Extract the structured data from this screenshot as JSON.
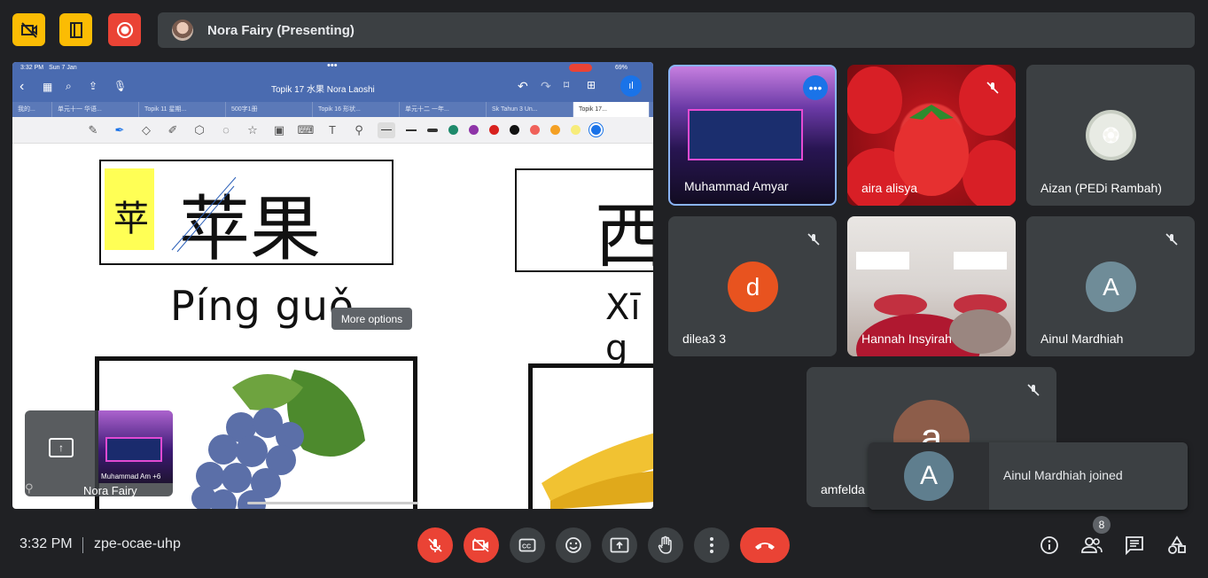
{
  "colors": {
    "bg": "#202124",
    "surface": "#3c4043",
    "yellow": "#fbbc04",
    "red": "#ea4335",
    "tileBorderActive": "#8ab4f8"
  },
  "topbar": {
    "presenter_name": "Nora Fairy (Presenting)"
  },
  "presentation": {
    "status_time": "3:32 PM",
    "status_date": "Sun 7 Jan",
    "status_battery": "69%",
    "doc_title": "Topik 17 水果  Nora Laoshi",
    "tabs": [
      "我的...",
      "单元十一 华语...",
      "Topik 11 星期...",
      "500字1册",
      "Topik 16 形状...",
      "单元十二 一年...",
      "Sk Tahun 3 Un...",
      "Topik 17..."
    ],
    "card1": {
      "small": "苹",
      "big": "苹果",
      "pinyin": "Píng guǒ"
    },
    "card2": {
      "big": "西",
      "pinyin": "Xī g"
    },
    "tooltip": "More options",
    "self_view": {
      "name": "Nora Fairy",
      "thumb_label": "Muhammad Am +6"
    }
  },
  "participants": [
    {
      "name": "Muhammad Amyar",
      "type": "video"
    },
    {
      "name": "aira alisya",
      "type": "video"
    },
    {
      "name": "Aizan (PEDi Rambah)",
      "type": "photo"
    },
    {
      "name": "dilea3 3",
      "type": "letter",
      "letter": "d",
      "color": "#e8531f"
    },
    {
      "name": "Hannah Insyirah",
      "type": "video"
    },
    {
      "name": "Ainul Mardhiah",
      "type": "letter",
      "letter": "A",
      "color": "#6f8c98"
    },
    {
      "name": "amfelda",
      "type": "letter",
      "letter": "a",
      "color": "#8d5d4a"
    }
  ],
  "toast": {
    "letter": "A",
    "message": "Ainul Mardhiah joined"
  },
  "bottombar": {
    "time": "3:32 PM",
    "meeting_code": "zpe-ocae-uhp",
    "people_count": "8"
  }
}
